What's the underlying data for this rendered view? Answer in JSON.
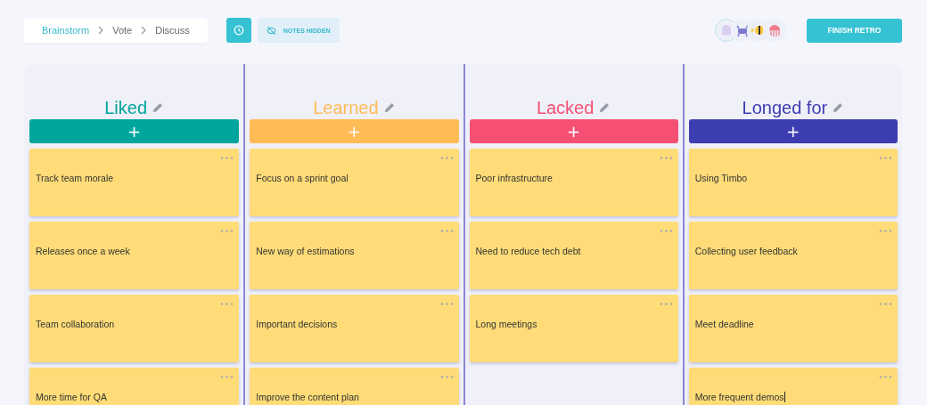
{
  "breadcrumb": [
    {
      "label": "Brainstorm",
      "selected": true
    },
    {
      "label": "Vote",
      "selected": false
    },
    {
      "label": "Discuss",
      "selected": false
    }
  ],
  "notes_toggle": {
    "label": "NOTES HIDDEN"
  },
  "avatars": [
    {
      "kind": "ghost",
      "selected": true
    },
    {
      "kind": "crab",
      "selected": false
    },
    {
      "kind": "fish",
      "selected": false
    },
    {
      "kind": "jellyfish",
      "selected": false
    }
  ],
  "finish_button": "FINISH RETRO",
  "columns": [
    {
      "title": "Liked",
      "color": "#00a59c",
      "add_label": "+",
      "cards": [
        {
          "text": "Track team morale",
          "editing": false
        },
        {
          "text": "Releases once a week",
          "editing": false
        },
        {
          "text": "Team collaboration",
          "editing": false
        },
        {
          "text": "More time for QA",
          "editing": false
        }
      ]
    },
    {
      "title": "Learned",
      "color": "#ffbb55",
      "add_label": "+",
      "cards": [
        {
          "text": "Focus on a sprint goal",
          "editing": false
        },
        {
          "text": "New way of estimations",
          "editing": false
        },
        {
          "text": "Important decisions",
          "editing": false
        },
        {
          "text": "Improve the content plan",
          "editing": false
        }
      ]
    },
    {
      "title": "Lacked",
      "color": "#f55074",
      "add_label": "+",
      "cards": [
        {
          "text": "Poor infrastructure",
          "editing": false
        },
        {
          "text": "Need to reduce tech debt",
          "editing": false
        },
        {
          "text": "Long meetings",
          "editing": false
        }
      ]
    },
    {
      "title": "Longed for",
      "color": "#3d3db2",
      "add_label": "+",
      "cards": [
        {
          "text": "Using Timbo",
          "editing": false
        },
        {
          "text": "Collecting user feedback",
          "editing": false
        },
        {
          "text": "Meet deadline",
          "editing": false
        },
        {
          "text": "More frequent demos",
          "editing": true
        }
      ]
    }
  ]
}
